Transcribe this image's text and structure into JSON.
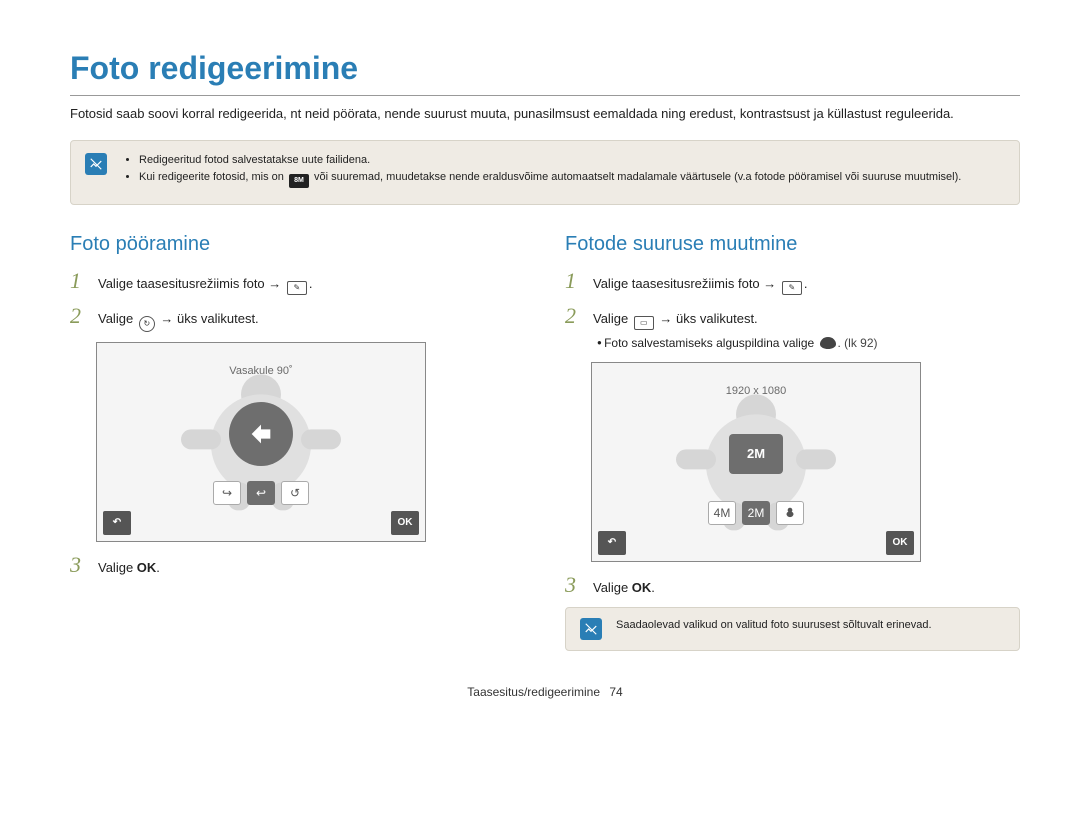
{
  "title": "Foto redigeerimine",
  "intro": "Fotosid saab soovi korral redigeerida, nt neid pöörata, nende suurust muuta, punasilmsust eemaldada ning eredust, kontrastsust ja küllastust reguleerida.",
  "notebox1": {
    "item1": "Redigeeritud fotod salvestatakse uute failidena.",
    "item2_a": "Kui redigeerite fotosid, mis on ",
    "item2_icon_text": "8M",
    "item2_b": " või suuremad, muudetakse nende eraldusvõime automaatselt madalamale väärtusele (v.a fotode pööramisel või suuruse muutmisel)."
  },
  "left": {
    "heading": "Foto pööramine",
    "step1": "Valige taasesitusrežiimis foto → ",
    "step2_a": "Valige ",
    "step2_b": " → üks valikutest.",
    "screen_caption": "Vasakule 90˚",
    "step3_a": "Valige ",
    "step3_ok": "OK",
    "step3_b": "."
  },
  "right": {
    "heading": "Fotode suuruse muutmine",
    "step1": "Valige taasesitusrežiimis foto → ",
    "step2_a": "Valige ",
    "step2_b": " → üks valikutest.",
    "sub_a": "Foto salvestamiseks alguspildina valige ",
    "sub_b": ". (lk 92)",
    "screen_caption": "1920 x 1080",
    "center_rect_text": "2M",
    "step3_a": "Valige ",
    "step3_ok": "OK",
    "step3_b": ".",
    "notebox2": "Saadaolevad valikud on valitud foto suurusest sõltuvalt erinevad."
  },
  "footer": {
    "label": "Taasesitus/redigeerimine",
    "page": "74"
  }
}
